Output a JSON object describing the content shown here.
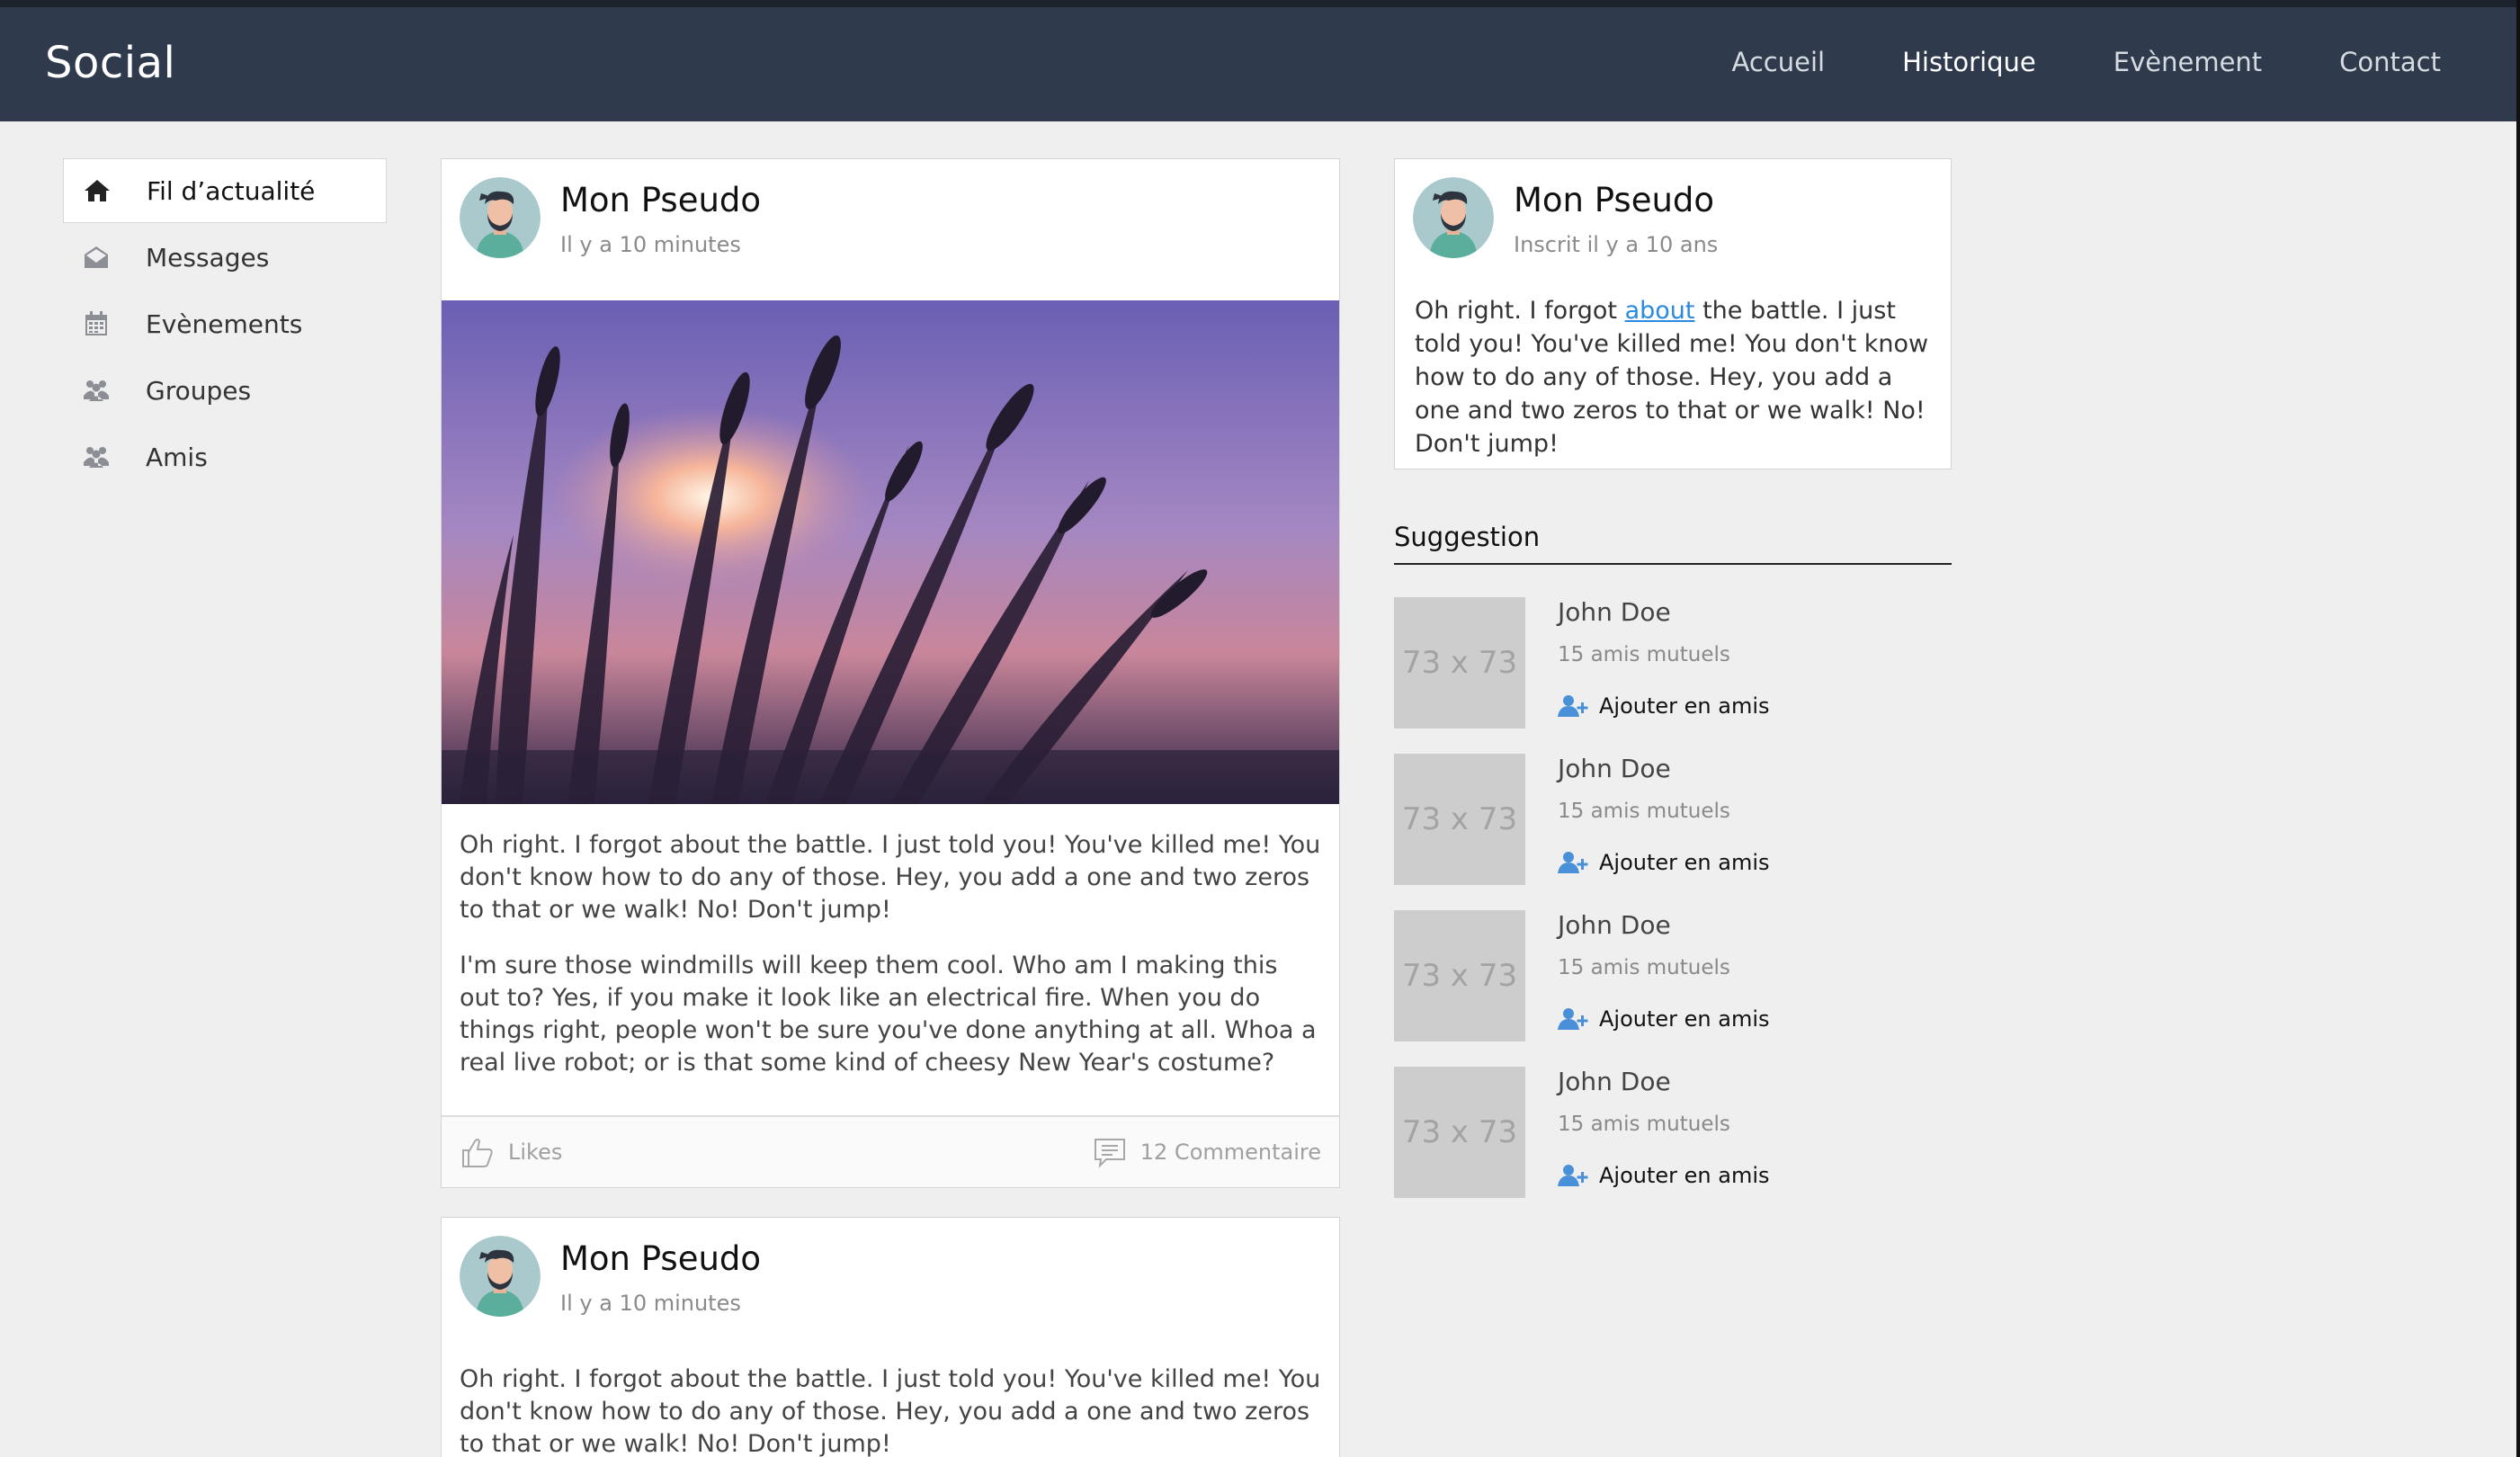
{
  "nav": {
    "brand": "Social",
    "links": [
      "Accueil",
      "Historique",
      "Evènement",
      "Contact"
    ],
    "active": "Historique"
  },
  "sidebar": {
    "items": [
      {
        "label": "Fil d’actualité",
        "icon": "home-icon"
      },
      {
        "label": "Messages",
        "icon": "envelope-icon"
      },
      {
        "label": "Evènements",
        "icon": "calendar-icon"
      },
      {
        "label": "Groupes",
        "icon": "users-icon"
      },
      {
        "label": "Amis",
        "icon": "users-icon"
      }
    ]
  },
  "posts": [
    {
      "author": "Mon Pseudo",
      "time": "Il y a 10 minutes",
      "paragraphs": [
        "Oh right. I forgot about the battle. I just told you! You've killed me! You don't know how to do any of those. Hey, you add a one and two zeros to that or we walk! No! Don't jump!",
        "I'm sure those windmills will keep them cool. Who am I making this out to? Yes, if you make it look like an electrical fire. When you do things right, people won't be sure you've done anything at all. Whoa a real live robot; or is that some kind of cheesy New Year's costume?"
      ],
      "likes_label": "Likes",
      "comments_label": "12 Commentaire"
    },
    {
      "author": "Mon Pseudo",
      "time": "Il y a 10 minutes",
      "paragraphs": [
        "Oh right. I forgot about the battle. I just told you! You've killed me! You don't know how to do any of those. Hey, you add a one and two zeros to that or we walk! No! Don't jump!"
      ]
    }
  ],
  "profile": {
    "name": "Mon Pseudo",
    "since": "Inscrit il y a 10 ans",
    "text_before": "Oh right. I forgot ",
    "link": "about",
    "text_after": " the battle. I just told you! You've killed me! You don't know how to do any of those. Hey, you add a one and two zeros to that or we walk! No! Don't jump!"
  },
  "suggestion": {
    "title": "Suggestion",
    "thumb_label": "73 x 73",
    "items": [
      {
        "name": "John Doe",
        "mutual": "15 amis mutuels",
        "action": "Ajouter en amis"
      },
      {
        "name": "John Doe",
        "mutual": "15 amis mutuels",
        "action": "Ajouter en amis"
      },
      {
        "name": "John Doe",
        "mutual": "15 amis mutuels",
        "action": "Ajouter en amis"
      },
      {
        "name": "John Doe",
        "mutual": "15 amis mutuels",
        "action": "Ajouter en amis"
      }
    ]
  },
  "colors": {
    "navbar": "#2f3b4c",
    "background": "#efefef",
    "link": "#2a8adf",
    "add_icon": "#4a90d9"
  }
}
